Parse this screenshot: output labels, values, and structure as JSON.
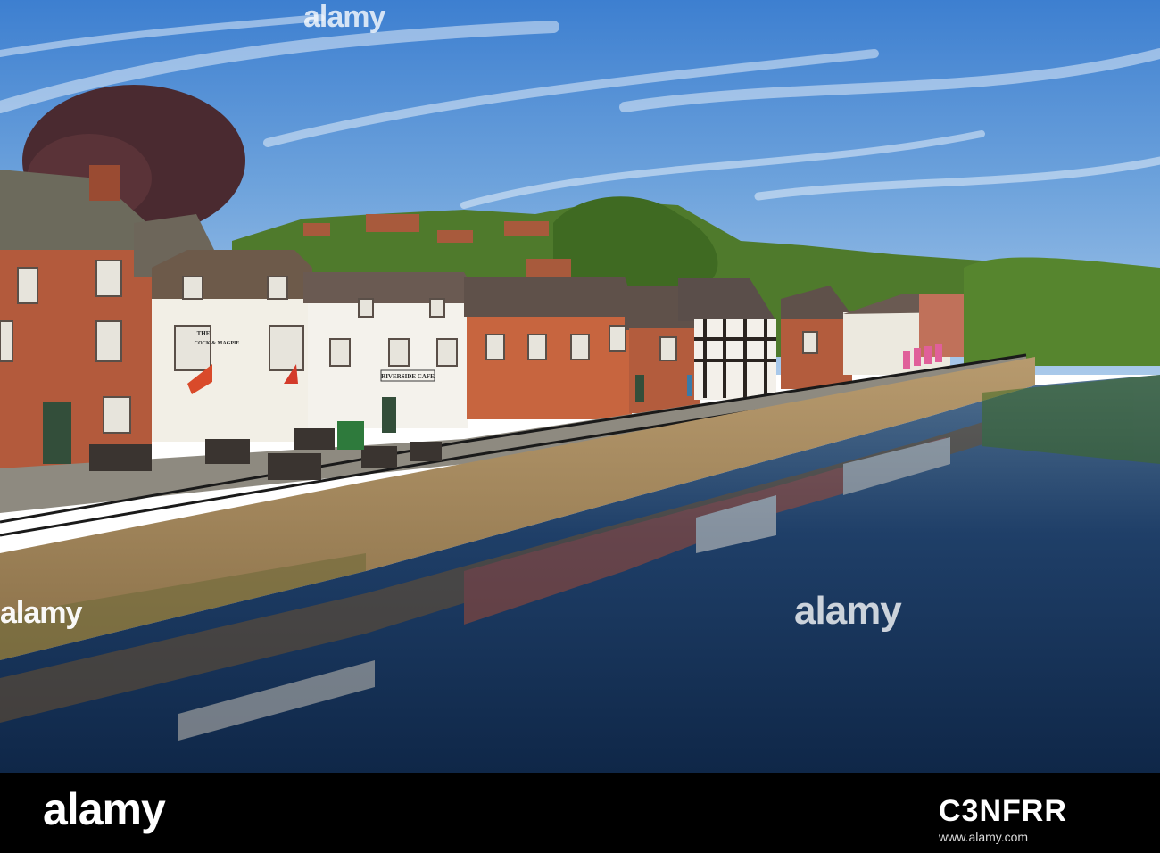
{
  "photo": {
    "signs": {
      "pub_line1": "THE",
      "pub_line2": "COCK & MAGPIE",
      "cafe": "RIVERSIDE CAFE"
    }
  },
  "watermark": {
    "text": "alamy"
  },
  "footer": {
    "logo": "alamy",
    "image_id": "C3NFRR",
    "url": "www.alamy.com"
  }
}
